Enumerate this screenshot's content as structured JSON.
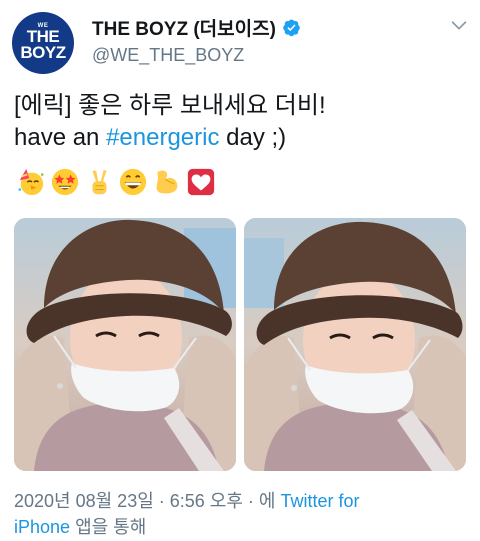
{
  "account": {
    "display_name": "THE BOYZ (더보이즈)",
    "handle": "@WE_THE_BOYZ",
    "verified": true,
    "avatar_text": {
      "small": "WE",
      "line1": "THE",
      "line2": "BOYZ"
    }
  },
  "tweet": {
    "line1": "[에릭] 좋은 하루 보내세요 더비!",
    "line2_before": "have an ",
    "hashtag": "#energeric",
    "line2_after": " day ;)",
    "emojis": [
      "party-face",
      "star-struck",
      "victory-hand",
      "grinning-face",
      "flexed-biceps",
      "heart-suit"
    ]
  },
  "media": {
    "count": 2
  },
  "meta": {
    "datetime": "2020년 08월 23일 · 6:56 오후 · 에 ",
    "source_link_1": "Twitter for",
    "source_link_2": "iPhone",
    "suffix": " 앱을 통해"
  },
  "colors": {
    "text": "#14171a",
    "muted": "#657786",
    "link": "#1b95e0",
    "verified": "#1da1f2",
    "avatar_bg": "#123a86"
  }
}
